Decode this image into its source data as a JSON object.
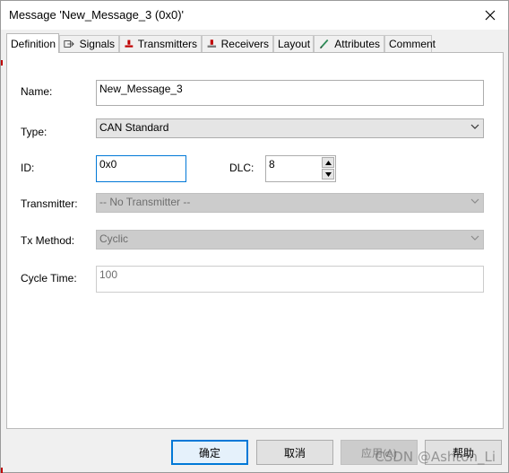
{
  "window": {
    "title": "Message 'New_Message_3 (0x0)'"
  },
  "tabs": [
    {
      "label": "Definition",
      "icon": "none"
    },
    {
      "label": "Signals",
      "icon": "signals-icon"
    },
    {
      "label": "Transmitters",
      "icon": "transmitter-icon"
    },
    {
      "label": "Receivers",
      "icon": "receiver-icon"
    },
    {
      "label": "Layout",
      "icon": "none"
    },
    {
      "label": "Attributes",
      "icon": "attributes-icon"
    },
    {
      "label": "Comment",
      "icon": "none"
    }
  ],
  "form": {
    "name_label": "Name:",
    "name_value": "New_Message_3",
    "type_label": "Type:",
    "type_value": "CAN Standard",
    "id_label": "ID:",
    "id_value": "0x0",
    "dlc_label": "DLC:",
    "dlc_value": "8",
    "transmitter_label": "Transmitter:",
    "transmitter_value": "-- No Transmitter --",
    "tx_method_label": "Tx Method:",
    "tx_method_value": "Cyclic",
    "cycle_time_label": "Cycle Time:",
    "cycle_time_value": "100"
  },
  "buttons": {
    "ok": "确定",
    "cancel": "取消",
    "apply": "应用(A)",
    "help": "帮助"
  },
  "watermark": "CSDN @Ashton_Li",
  "colors": {
    "accent": "#0078d7",
    "tab_icon_red": "#c00000",
    "attributes_icon_green": "#2e8b57"
  }
}
